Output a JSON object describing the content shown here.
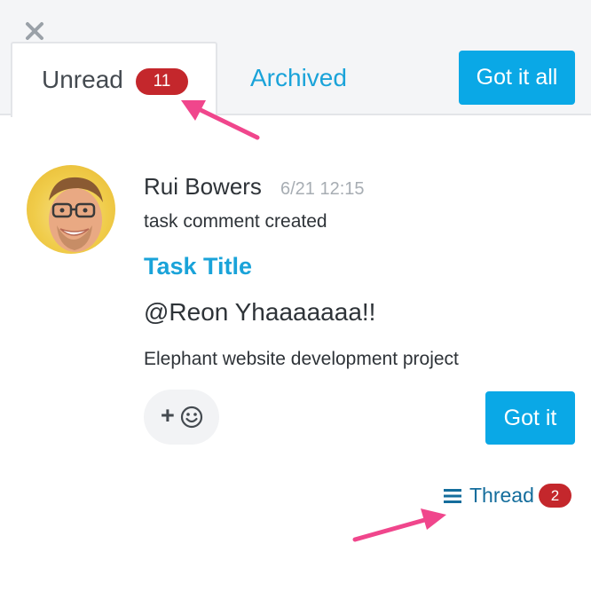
{
  "tabs": {
    "unread_label": "Unread",
    "unread_count": "11",
    "archived_label": "Archived"
  },
  "toolbar": {
    "got_it_all_label": "Got it all"
  },
  "notification": {
    "user_name": "Rui Bowers",
    "timestamp": "6/21 12:15",
    "event": "task comment created",
    "task_title": "Task Title",
    "message": "@Reon Yhaaaaaaa!!",
    "project": "Elephant website development project",
    "reaction_plus": "+",
    "got_it_label": "Got it",
    "thread_label": "Thread",
    "thread_count": "2"
  },
  "icons": {
    "close": "close-icon",
    "smiley": "smiley-icon",
    "thread": "hamburger-icon",
    "avatar": "avatar-photo"
  },
  "colors": {
    "accent": "#0aa8e6",
    "link": "#1aa3d9",
    "badge": "#c4272c",
    "annotation_arrow": "#f0468c"
  }
}
